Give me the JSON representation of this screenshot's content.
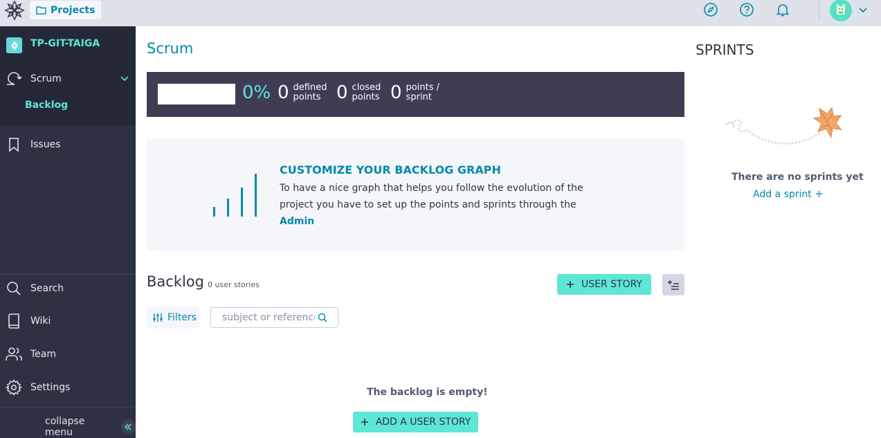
{
  "topbar": {
    "projects_label": "Projects",
    "icons": [
      "discover-icon",
      "help-icon",
      "notifications-icon"
    ]
  },
  "sidebar": {
    "project_name": "TP-GIT-TAIGA",
    "scrum_label": "Scrum",
    "backlog_label": "Backlog",
    "issues_label": "Issues",
    "search_label": "Search",
    "wiki_label": "Wiki",
    "team_label": "Team",
    "settings_label": "Settings",
    "collapse_label": "collapse menu"
  },
  "main": {
    "title": "Scrum",
    "summary": {
      "progress_fraction": 0,
      "percent": "0%",
      "defined_value": "0",
      "defined_label_1": "defined",
      "defined_label_2": "points",
      "closed_value": "0",
      "closed_label_1": "closed",
      "closed_label_2": "points",
      "sprint_value": "0",
      "sprint_label_1": "points /",
      "sprint_label_2": "sprint"
    },
    "customize": {
      "title": "CUSTOMIZE YOUR BACKLOG GRAPH",
      "text": "To have a nice graph that helps you follow the evolution of the project you have to set up the points and sprints through the",
      "link": "Admin"
    },
    "backlog": {
      "title": "Backlog",
      "count": "0 user stories",
      "add_button": "USER STORY",
      "filters_label": "Filters",
      "search_placeholder": "subject or reference",
      "empty_text": "The backlog is empty!",
      "add_story_button": "ADD A USER STORY"
    }
  },
  "sprints": {
    "title": "SPRINTS",
    "empty_text": "There are no sprints yet",
    "add_label": "Add a sprint"
  },
  "colors": {
    "accent": "#5ee6d6",
    "link": "#008aa8",
    "sidebar": "#2e3142",
    "summary_bg": "#403c54"
  }
}
